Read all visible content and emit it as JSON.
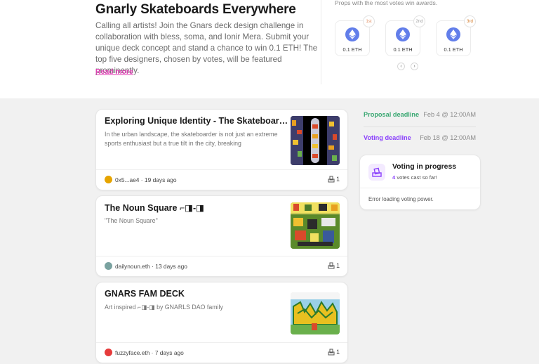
{
  "header": {
    "title": "Gnarly Skateboards Everywhere",
    "description": "Calling all artists! Join the Gnars deck design challenge in collaboration with bless, soma, and Ionir Mera. Submit your unique deck concept and stand a chance to win 0.1 ETH! The top five designers, chosen by votes, will be featured prominently.",
    "read_more": "Read more"
  },
  "awards": {
    "note": "Props with the most votes win awards.",
    "items": [
      {
        "place": "1st",
        "amount": "0.1 ETH",
        "icon": "ethereum-icon"
      },
      {
        "place": "2nd",
        "amount": "0.1 ETH",
        "icon": "ethereum-icon"
      },
      {
        "place": "3rd",
        "amount": "0.1 ETH",
        "icon": "ethereum-icon"
      }
    ],
    "prev": "‹",
    "next": "›"
  },
  "proposals": [
    {
      "title": "Exploring Unique Identity - The Skateboarder's Perspective",
      "description": "In the urban landscape, the skateboarder is not just an extreme sports enthusiast but a true tilt in the city, breaking",
      "author": "0x5...ae4",
      "age": "19 days ago",
      "votes": "1",
      "avatar_color": "#e6a400"
    },
    {
      "title": "The Noun Square ⌐◨-◨",
      "description": "\"The Noun Square\"",
      "author": "dailynoun.eth",
      "age": "13 days ago",
      "votes": "1",
      "avatar_color": "#7aa2a0"
    },
    {
      "title": "GNARS FAM DECK",
      "description": "Art inspired ⌐◨-◨ by GNARLS DAO family",
      "author": "fuzzyface.eth",
      "age": "7 days ago",
      "votes": "1",
      "avatar_color": "#e63b3b"
    }
  ],
  "deadlines": {
    "proposal_label": "Proposal deadline",
    "proposal_value": "Feb 4 @ 12:00AM",
    "proposal_color": "#3aa872",
    "voting_label": "Voting deadline",
    "voting_value": "Feb 18 @ 12:00AM",
    "voting_color": "#8a3ffc"
  },
  "status": {
    "title": "Voting in progress",
    "votes_count": "4",
    "votes_suffix": " votes cast so far!",
    "error": "Error loading voting power.",
    "icon": "ballot-box-icon"
  }
}
